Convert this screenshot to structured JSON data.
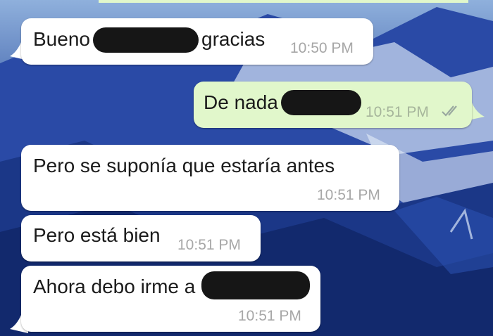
{
  "messages": [
    {
      "direction": "incoming",
      "text_before": "Bueno",
      "text_after": "gracias",
      "time": "10:50 PM",
      "redacted": true
    },
    {
      "direction": "outgoing",
      "text_before": "De nada",
      "time": "10:51 PM",
      "redacted": true,
      "status": "read"
    },
    {
      "direction": "incoming",
      "text_before": "Pero se suponía que estaría antes",
      "time": "10:51 PM",
      "redacted": false
    },
    {
      "direction": "incoming",
      "text_before": "Pero está bien",
      "time": "10:51 PM",
      "redacted": false
    },
    {
      "direction": "incoming",
      "text_before": "Ahora debo irme a",
      "time": "10:51 PM",
      "redacted": true
    }
  ],
  "colors": {
    "incoming_bubble": "#ffffff",
    "outgoing_bubble": "#e1f7cb",
    "wallpaper": "#17307a",
    "timestamp": "#a7a7a7",
    "read_ticks": "#9aa9a0"
  },
  "icons": {
    "read_receipt": "double-check-icon"
  }
}
